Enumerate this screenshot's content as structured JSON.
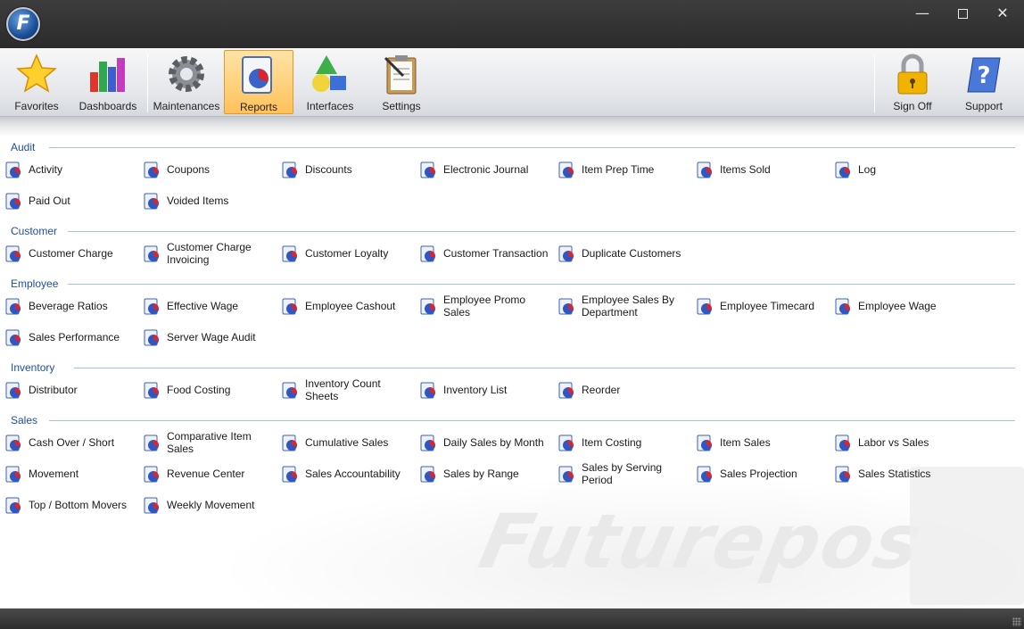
{
  "window": {
    "logo_letter": "F",
    "controls": {
      "minimize": "—",
      "close": "✕"
    }
  },
  "toolbar": {
    "items": [
      {
        "label": "Favorites",
        "icon": "star-icon"
      },
      {
        "label": "Dashboards",
        "icon": "bar-chart-icon"
      },
      {
        "label": "Maintenances",
        "icon": "gear-icon"
      },
      {
        "label": "Reports",
        "icon": "report-icon",
        "active": true
      },
      {
        "label": "Interfaces",
        "icon": "shapes-icon"
      },
      {
        "label": "Settings",
        "icon": "clipboard-icon"
      },
      {
        "label": "Sign Off",
        "icon": "padlock-icon"
      },
      {
        "label": "Support",
        "icon": "help-book-icon"
      }
    ],
    "active_color": "#ffc15a"
  },
  "sections": [
    {
      "title": "Audit",
      "reports": [
        "Activity",
        "Coupons",
        "Discounts",
        "Electronic Journal",
        "Item Prep Time",
        "Items Sold",
        "Log",
        "Paid Out",
        "Voided Items"
      ]
    },
    {
      "title": "Customer",
      "reports": [
        "Customer Charge",
        "Customer Charge Invoicing",
        "Customer Loyalty",
        "Customer Transaction",
        "Duplicate Customers"
      ]
    },
    {
      "title": "Employee",
      "reports": [
        "Beverage Ratios",
        "Effective Wage",
        "Employee Cashout",
        "Employee Promo Sales",
        "Employee Sales By Department",
        "Employee Timecard",
        "Employee Wage",
        "Sales Performance",
        "Server Wage Audit"
      ]
    },
    {
      "title": "Inventory",
      "reports": [
        "Distributor",
        "Food Costing",
        "Inventory Count Sheets",
        "Inventory List",
        "Reorder"
      ]
    },
    {
      "title": "Sales",
      "reports": [
        "Cash Over / Short",
        "Comparative Item Sales",
        "Cumulative Sales",
        "Daily Sales by Month",
        "Item Costing",
        "Item Sales",
        "Labor vs Sales",
        "Movement",
        "Revenue Center",
        "Sales Accountability",
        "Sales by Range",
        "Sales by Serving Period",
        "Sales Projection",
        "Sales Statistics",
        "Top / Bottom Movers",
        "Weekly Movement"
      ]
    }
  ],
  "watermark": "Futurepos",
  "colors": {
    "section_header": "#1f4fa0",
    "titlebar": "#2b2b2b"
  }
}
